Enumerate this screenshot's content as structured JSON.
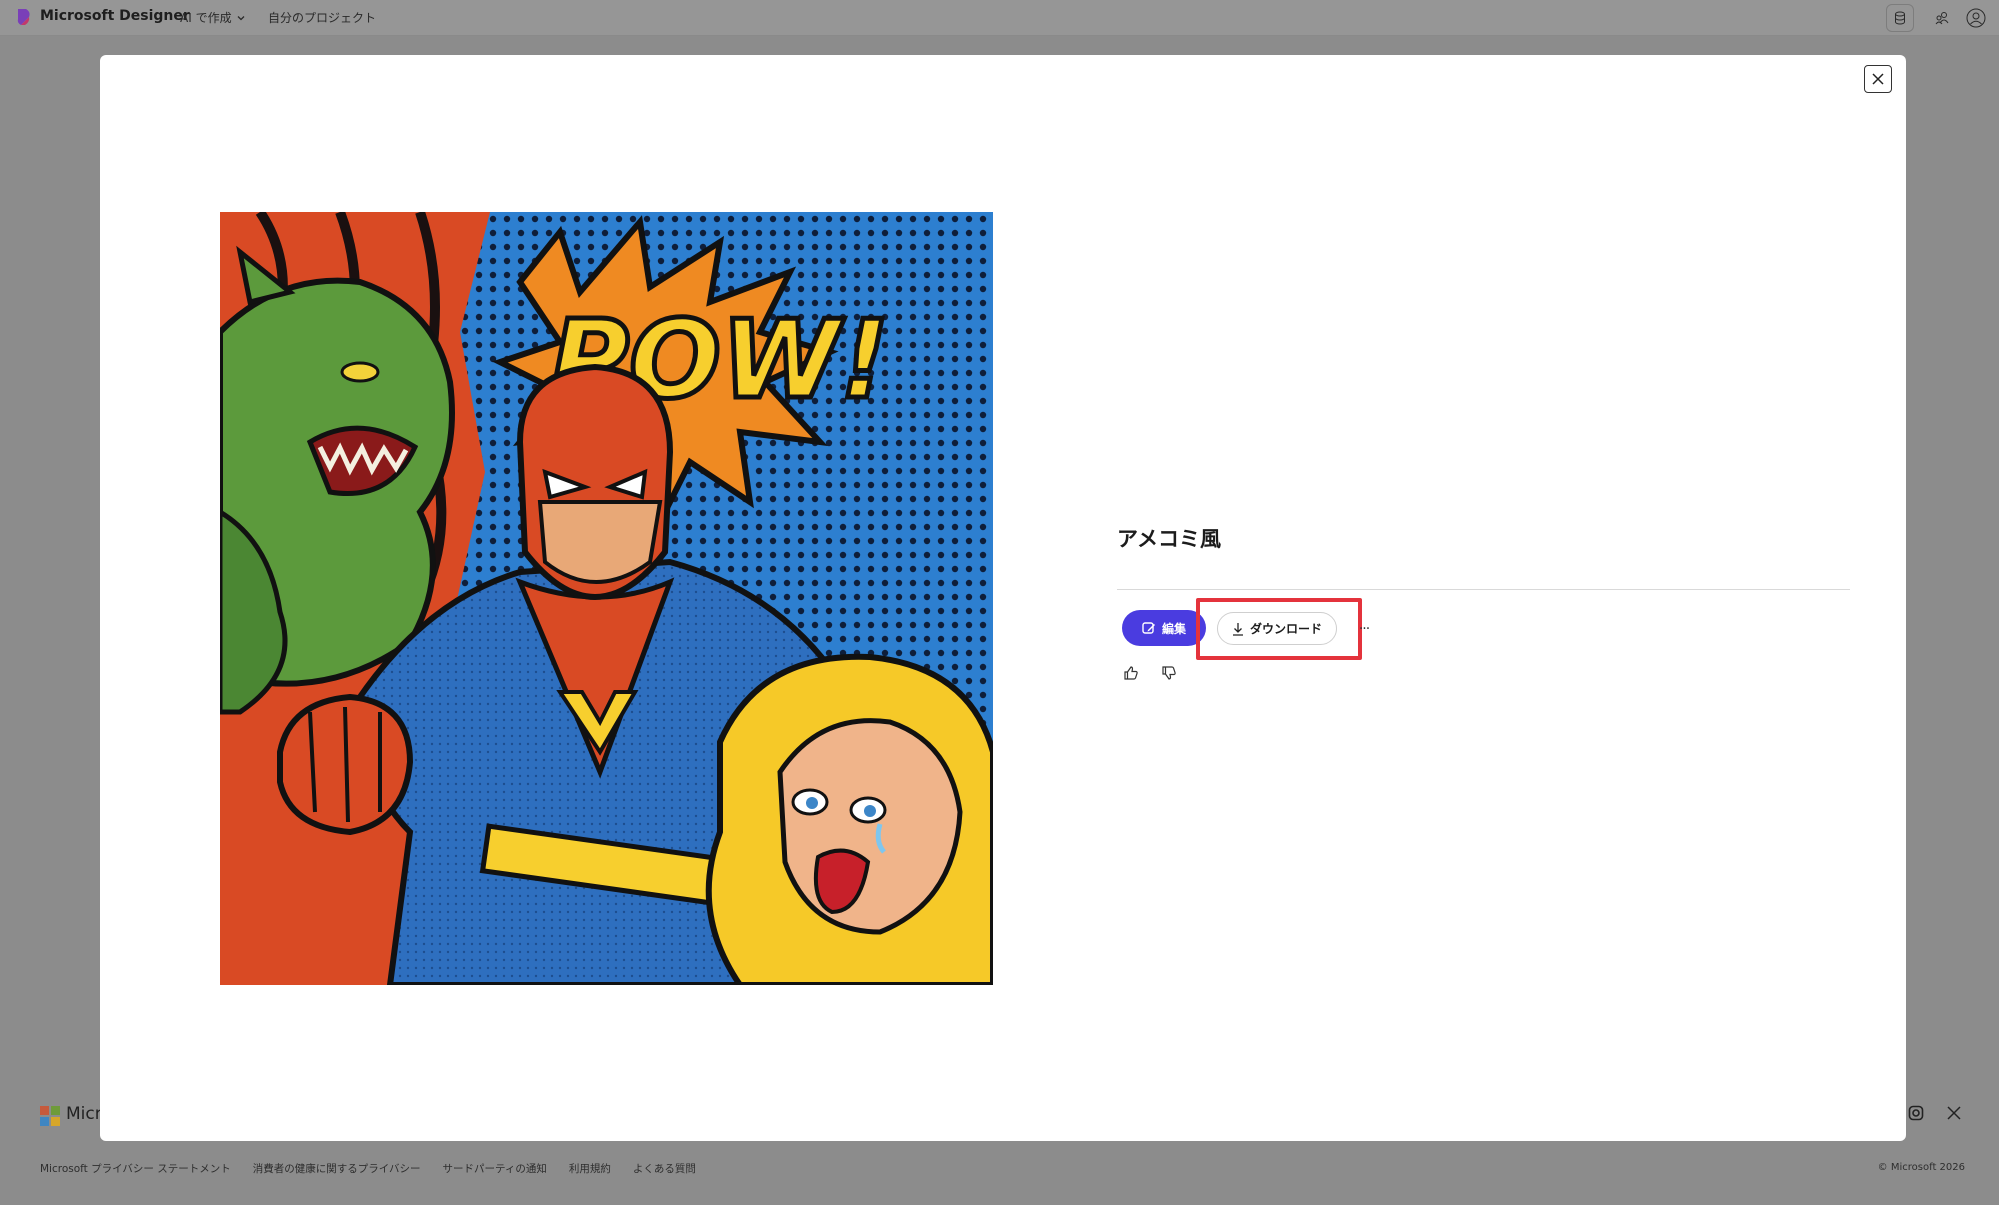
{
  "header": {
    "app_name": "Microsoft Designer",
    "create_label": "AI で作成",
    "projects_label": "自分のプロジェクト"
  },
  "modal": {
    "title": "アメコミ風",
    "image_alt": "POW!",
    "comic_text": "POW!",
    "chest_letter": "V",
    "edit_label": "編集",
    "download_label": "ダウンロード",
    "more_label": "···"
  },
  "background_footer": {
    "brand_fragment": "Micr",
    "links": [
      "Microsoft プライバシー ステートメント",
      "消費者の健康に関するプライバシー",
      "サードパーティの通知",
      "利用規約",
      "よくある質問"
    ],
    "copyright": "© Microsoft 2026"
  },
  "colors": {
    "accent": "#4a3ce0",
    "highlight": "#e4333c",
    "overlay": "#8c8c8c"
  },
  "icons": {
    "close": "close-icon",
    "download": "download-arrow-icon",
    "edit": "edit-image-icon",
    "like": "thumbs-up-icon",
    "dislike": "thumbs-down-icon"
  }
}
